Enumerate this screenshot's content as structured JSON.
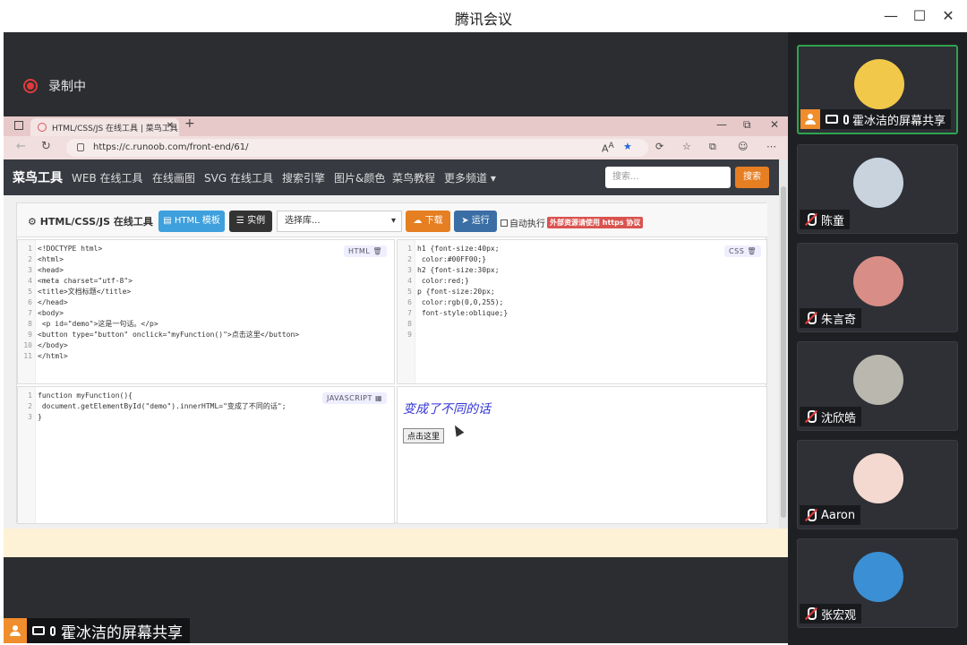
{
  "window": {
    "title": "腾讯会议"
  },
  "recording": {
    "label": "录制中"
  },
  "browser": {
    "tab_title": "HTML/CSS/JS 在线工具 | 菜鸟工具",
    "url": "https://c.runoob.com/front-end/61/"
  },
  "site": {
    "logo": "菜鸟工具",
    "nav": [
      "WEB 在线工具",
      "在线画图",
      "SVG 在线工具",
      "搜索引擎",
      "图片&颜色",
      "菜鸟教程",
      "更多频道 ▾"
    ],
    "search_placeholder": "搜索...",
    "search_btn": "搜索"
  },
  "toolbar": {
    "title": "HTML/CSS/JS 在线工具",
    "html_template": "HTML 模板",
    "examples": "实例",
    "library_select": "选择库...",
    "download": "下载",
    "run": "运行",
    "auto_run": "自动执行",
    "https_badge": "外部资源请使用 https 协议"
  },
  "editors": {
    "html_label": "HTML",
    "css_label": "CSS",
    "js_label": "JAVASCRIPT"
  },
  "html_code": [
    "<!DOCTYPE html>",
    "<html>",
    "<head>",
    "<meta charset=\"utf-8\">",
    "<title>文档标题</title>",
    "</head>",
    "<body>",
    "  <p id=\"demo\">这是一句话。</p>",
    "<button type=\"button\" onclick=\"myFunction()\">点击这里</button>",
    "</body>",
    "</html>"
  ],
  "css_code": [
    "h1 {font-size:40px;",
    "   color:#00FF00;}",
    "h2 {font-size:30px;",
    "   color:red;}",
    "p {font-size:20px;",
    "   color:rgb(0,0,255);",
    "   font-style:oblique;}",
    "",
    ""
  ],
  "js_code": [
    "function myFunction(){",
    " document.getElementById(\"demo\").innerHTML=\"变成了不同的话\";",
    "}"
  ],
  "output": {
    "text": "变成了不同的话",
    "button": "点击这里"
  },
  "presenter": {
    "name": "霍冰洁的屏幕共享"
  },
  "participants": [
    {
      "name": "霍冰洁的屏幕共享",
      "active": true,
      "color": "#f2c84b"
    },
    {
      "name": "陈童",
      "active": false,
      "color": "#c9d3de"
    },
    {
      "name": "朱言奇",
      "active": false,
      "color": "#d88e86"
    },
    {
      "name": "沈欣皓",
      "active": false,
      "color": "#b9b7ae"
    },
    {
      "name": "Aaron",
      "active": false,
      "color": "#f3d9cf"
    },
    {
      "name": "张宏观",
      "active": false,
      "color": "#3b8fd4"
    }
  ]
}
